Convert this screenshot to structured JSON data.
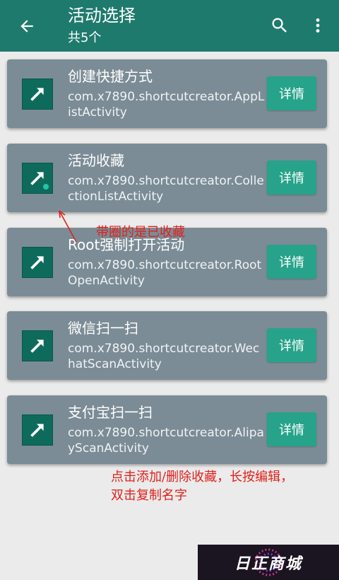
{
  "appbar": {
    "title": "活动选择",
    "subtitle": "共5个",
    "back_icon": "arrow-back-icon",
    "search_icon": "search-icon",
    "more_icon": "more-vert-icon",
    "color": "#1f7a6e"
  },
  "activities": [
    {
      "name": "创建快捷方式",
      "package": "com.x7890.shortcutcreator.AppListActivity",
      "detail": "详情",
      "favorited": false
    },
    {
      "name": "活动收藏",
      "package": "com.x7890.shortcutcreator.CollectionListActivity",
      "detail": "详情",
      "favorited": true
    },
    {
      "name": "Root强制打开活动",
      "package": "com.x7890.shortcutcreator.RootOpenActivity",
      "detail": "详情",
      "favorited": false
    },
    {
      "name": "微信扫一扫",
      "package": "com.x7890.shortcutcreator.WechatScanActivity",
      "detail": "详情",
      "favorited": false
    },
    {
      "name": "支付宝扫一扫",
      "package": "com.x7890.shortcutcreator.AlipayScanActivity",
      "detail": "详情",
      "favorited": false
    }
  ],
  "annotations": {
    "favorite_hint": "带圈的是已收藏",
    "usage_hint_line1": "点击添加/删除收藏，长按编辑，",
    "usage_hint_line2": "双击复制名字",
    "color": "#e0211c"
  },
  "watermark": {
    "text": "日正商城"
  }
}
